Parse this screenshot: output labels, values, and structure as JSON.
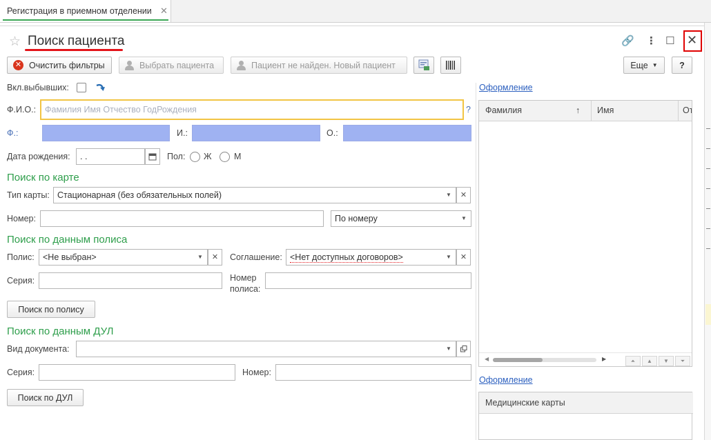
{
  "tab": {
    "label": "Регистрация в приемном отделении",
    "close": "✕"
  },
  "window": {
    "title": "Поиск пациента",
    "link_icon": "🔗",
    "more_icon": "⋮",
    "max_icon": "☐",
    "close_icon": "✕"
  },
  "toolbar": {
    "clear_filters": "Очистить фильтры",
    "select_patient": "Выбрать пациента",
    "new_patient": "Пациент не найден. Новый пациент",
    "more": "Еще",
    "help": "?"
  },
  "form": {
    "incl_discharged": "Вкл.выбывших:",
    "fio_label": "Ф.И.О.:",
    "fio_placeholder": "Фамилия Имя Отчество ГодРождения",
    "fio_help": "?",
    "f_label": "Ф.:",
    "i_label": "И.:",
    "o_label": "О.:",
    "dob_label": "Дата рождения:",
    "dob_value": " .  .",
    "sex_label": "Пол:",
    "sex_f": "Ж",
    "sex_m": "М"
  },
  "card_search": {
    "heading": "Поиск по  карте",
    "type_label": "Тип карты:",
    "type_value": "Стационарная (без обязательных полей)",
    "number_label": "Номер:",
    "mode_value": "По номеру"
  },
  "policy_search": {
    "heading": "Поиск по данным полиса",
    "policy_label": "Полис:",
    "policy_value": "<Не выбран>",
    "agreement_label": "Соглашение:",
    "agreement_value": "<Нет доступных договоров>",
    "series_label": "Серия:",
    "number_label_1": "Номер",
    "number_label_2": "полиса:",
    "button": "Поиск по полису"
  },
  "dul_search": {
    "heading": "Поиск по данным ДУЛ",
    "doc_type_label": "Вид документа:",
    "series_label": "Серия:",
    "number_label": "Номер:",
    "button": "Поиск по ДУЛ"
  },
  "right_panel": {
    "appearance_link": "Оформление",
    "columns": [
      "Фамилия",
      "Имя",
      "От"
    ],
    "sort_mark": "↑",
    "appearance_link_2": "Оформление",
    "med_cards": "Медицинские карты"
  },
  "colors": {
    "accent_green": "#2e9e4b",
    "highlight_red": "#e3141a",
    "blue_field": "#9fb2f2",
    "focus_yellow": "#f2c443",
    "link_blue": "#2b5fbf"
  }
}
